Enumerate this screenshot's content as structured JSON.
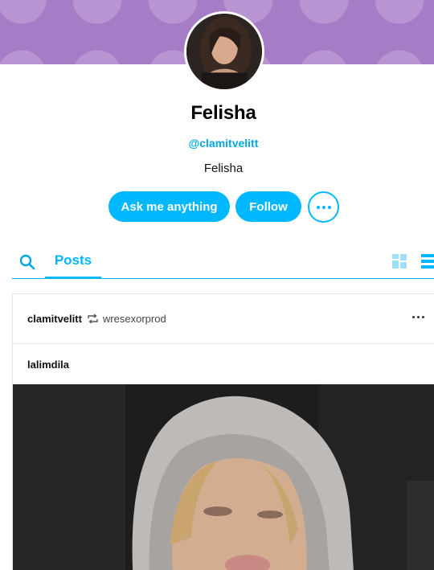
{
  "profile": {
    "name": "Felisha",
    "handle": "@clamitvelitt",
    "bio": "Felisha",
    "avatar_icon": "profile-photo",
    "banner_color": "#a77cc6"
  },
  "actions": {
    "ask_label": "Ask me anything",
    "follow_label": "Follow",
    "more_icon": "more-horizontal-icon"
  },
  "tabs": {
    "search_icon": "search-icon",
    "posts_label": "Posts",
    "grid_icon": "grid-view-icon",
    "list_icon": "list-view-icon"
  },
  "post": {
    "author": "clamitvelitt",
    "reblog_icon": "reblog-icon",
    "source": "wresexorprod",
    "reblog_author": "lalimdila",
    "image": "photo-of-person-in-grey-hoodie"
  },
  "colors": {
    "accent": "#00b8ff",
    "handle": "#00a8e6"
  }
}
